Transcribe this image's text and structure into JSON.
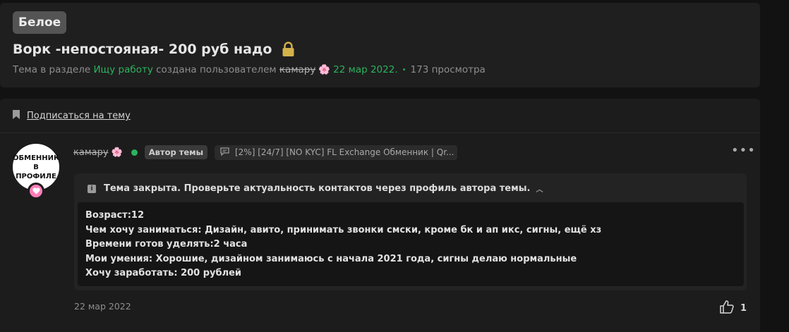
{
  "thread": {
    "prefix": "Белое",
    "title": "Ворк -непостояная- 200 руб надо",
    "meta": {
      "section_prefix": "Тема в разделе",
      "section_link": "Ищу работу",
      "created_by": "создана пользователем",
      "author": "камару",
      "date": "22 мар 2022.",
      "views": "173 просмотра"
    }
  },
  "subscribe": {
    "label": "Подписаться на тему"
  },
  "post": {
    "avatar_text_line1": "ОБМЕННИК",
    "avatar_text_line2": "В ПРОФИЛЕ",
    "username": "камару",
    "author_badge": "Автор темы",
    "signature": "[2%] [24/7] [NO KYC] FL Exchange Обменник | Qr...",
    "notice": "Тема закрыта. Проверьте актуальность контактов через профиль автора темы.",
    "body_lines": [
      "Возраст:12",
      "Чем хочу заниматься: Дизайн, авито, принимать звонки смски, кроме бк и ап икс, сигны, ещё хз",
      "Времени готов уделять:2 часа",
      "Мои умения: Хорошие, дизайном занимаюсь с начала 2021 года, сигны делаю нормальные",
      "Хочу заработать: 200 рублей"
    ],
    "date": "22 мар 2022",
    "likes": "1"
  },
  "icons": {
    "lock": "lock-icon",
    "sakura": "flower-icon",
    "bookmark": "bookmark-icon",
    "info": "info-icon",
    "chevron": "chevron-up-icon",
    "chat": "chat-icon",
    "more": "more-icon",
    "like": "thumbs-up-icon"
  },
  "colors": {
    "background": "#121212",
    "card": "#1f1f1f",
    "accent_green": "#2bb35e",
    "prefix_bg": "#545454",
    "lock_gold": "#d4b14a",
    "badge_pink": "#ff7eb9"
  }
}
